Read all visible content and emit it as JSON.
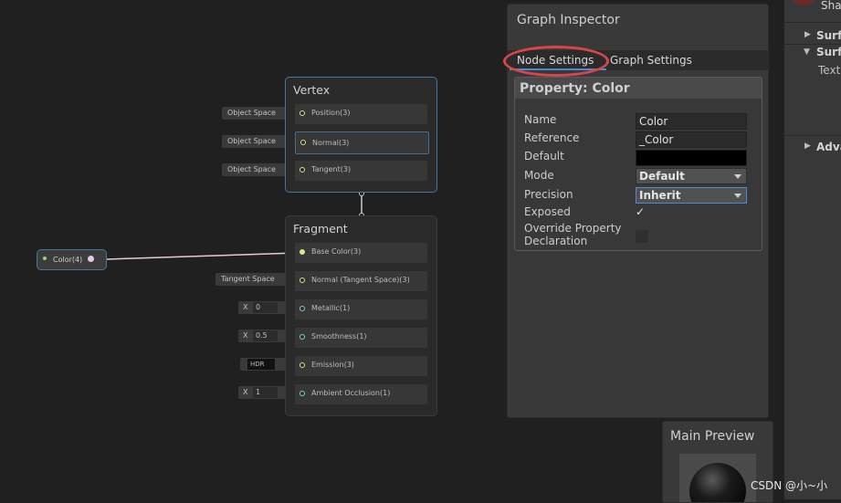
{
  "vertex": {
    "title": "Vertex",
    "inputs": [
      {
        "space": "Object Space",
        "label": "Position(3)"
      },
      {
        "space": "Object Space",
        "label": "Normal(3)"
      },
      {
        "space": "Object Space",
        "label": "Tangent(3)"
      }
    ]
  },
  "fragment": {
    "title": "Fragment",
    "base_color": "Base Color(3)",
    "normal_space": "Tangent Space",
    "normal": "Normal (Tangent Space)(3)",
    "metallic_x": "X",
    "metallic_value": "0",
    "metallic": "Metallic(1)",
    "smoothness_x": "X",
    "smoothness_value": "0.5",
    "smoothness": "Smoothness(1)",
    "emission_hdr": "HDR",
    "emission": "Emission(3)",
    "ao_x": "X",
    "ao_value": "1",
    "ao": "Ambient Occlusion(1)"
  },
  "color_node": {
    "label": "Color(4)"
  },
  "inspector": {
    "title": "Graph Inspector",
    "tabs": [
      "Node Settings",
      "Graph Settings"
    ],
    "active_tab": "Node Settings",
    "property_title": "Property: Color",
    "fields": {
      "name_label": "Name",
      "name_value": "Color",
      "reference_label": "Reference",
      "reference_value": "_Color",
      "default_label": "Default",
      "default_color": "#000000",
      "mode_label": "Mode",
      "mode_value": "Default",
      "precision_label": "Precision",
      "precision_value": "Inherit",
      "exposed_label": "Exposed",
      "exposed_checked": "✓",
      "override_label_1": "Override Property",
      "override_label_2": "Declaration"
    }
  },
  "preview": {
    "title": "Main Preview"
  },
  "right_panel": {
    "top": "Sha",
    "item1": "Surfa",
    "item2": "Surfa",
    "item2_child": "Text",
    "item3": "Adva"
  },
  "colors": {
    "accent": "#4a8ad6",
    "highlight": "#d9454a",
    "selection": "#44779c"
  },
  "watermark": "CSDN @小~小"
}
